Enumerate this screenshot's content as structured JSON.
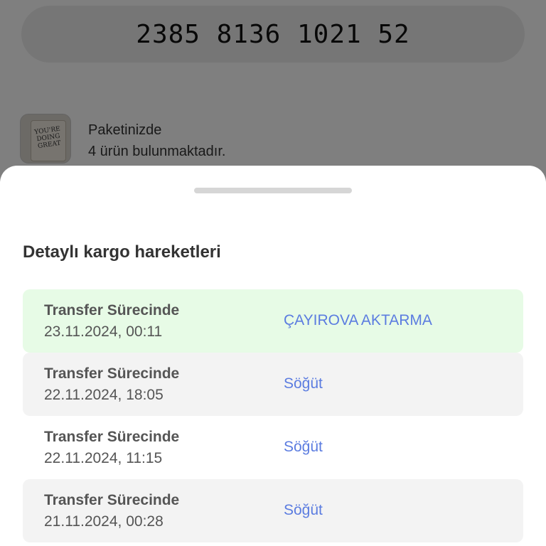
{
  "tracking": {
    "number": "2385 8136 1021 52"
  },
  "package": {
    "line1": "Paketinizde",
    "line2": "4 ürün bulunmaktadır.",
    "thumb_text": "YOU'RE DOING GREAT"
  },
  "sheet": {
    "title": "Detaylı kargo hareketleri",
    "movements": [
      {
        "status": "Transfer Sürecinde",
        "date": "23.11.2024, 00:11",
        "location": "ÇAYIROVA AKTARMA",
        "highlighted": true
      },
      {
        "status": "Transfer Sürecinde",
        "date": "22.11.2024, 18:05",
        "location": "Söğüt"
      },
      {
        "status": "Transfer Sürecinde",
        "date": "22.11.2024, 11:15",
        "location": "Söğüt"
      },
      {
        "status": "Transfer Sürecinde",
        "date": "21.11.2024, 00:28",
        "location": "Söğüt"
      }
    ]
  },
  "colors": {
    "highlight_bg": "#e7fbe6",
    "location_text": "#5b7ce0",
    "row_shaded_bg": "#f3f3f3"
  }
}
